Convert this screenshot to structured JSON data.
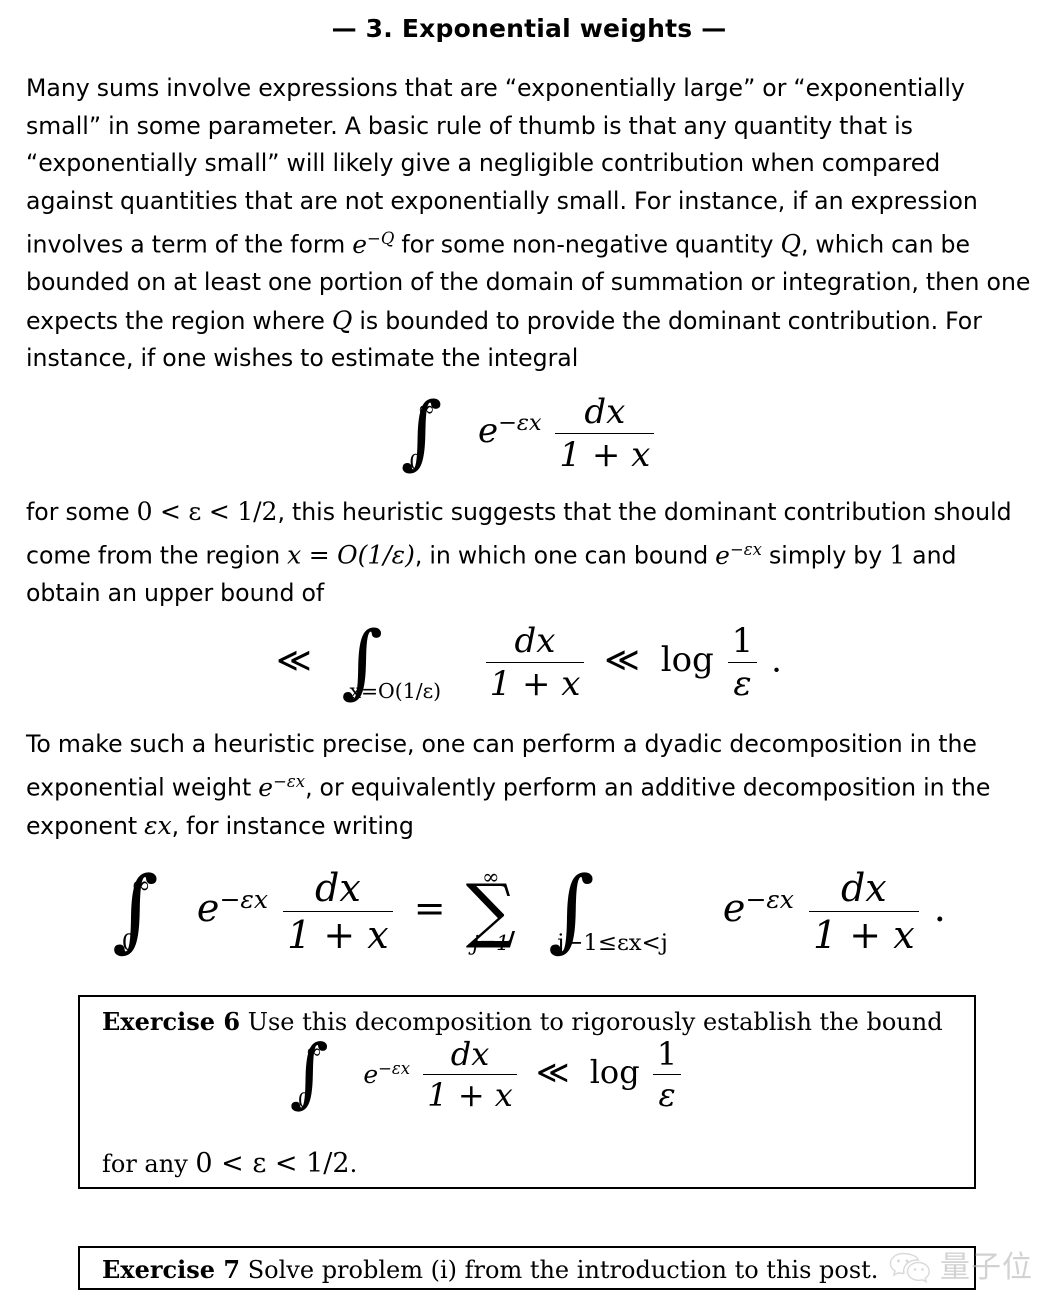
{
  "document": {
    "title": "— 3. Exponential weights —",
    "paragraphs": {
      "p1": {
        "seg1": "Many sums involve expressions that are “exponentially large” or “exponentially small” in some parameter. A basic rule of thumb is that any quantity that is “exponentially small” will likely give a negligible contribution when compared against quantities that are not exponentially small. For instance, if an expression involves a term of the form ",
        "math1_base": "e",
        "math1_exp": "−Q",
        "seg2": " for some non-negative quantity ",
        "math2": "Q",
        "seg3": ", which can be bounded on at least one portion of the domain of summation or integration, then one expects the region where ",
        "math3": "Q",
        "seg4": " is bounded to provide the dominant contribution. For instance, if one wishes to estimate the integral"
      },
      "p2": {
        "seg1": "for some ",
        "math1": "0 < ε < 1/2",
        "seg2": ", this heuristic suggests that the dominant contribution should come from the region ",
        "math2": "x = O(1/ε)",
        "seg3": ", in which one can bound ",
        "math3_base": "e",
        "math3_exp": "−εx",
        "seg4": " simply by ",
        "math4": "1",
        "seg5": " and obtain an upper bound of"
      },
      "p3": {
        "seg1": "To make such a heuristic precise, one can perform a dyadic decomposition in the exponential weight ",
        "math1_base": "e",
        "math1_exp": "−εx",
        "seg2": ", or equivalently perform an additive decomposition in the exponent ",
        "math2": "εx",
        "seg3": ", for instance writing"
      }
    },
    "equations": {
      "eq1": {
        "integral_lower": "0",
        "integral_upper": "∞",
        "exp_base": "e",
        "exp_sup": "−εx",
        "frac_num": "dx",
        "frac_den": "1 + x"
      },
      "eq2": {
        "lead_op": "≪",
        "integral_lower": "x=O(1/ε)",
        "frac_num": "dx",
        "frac_den": "1 + x",
        "mid_op": "≪",
        "log": "log",
        "log_num": "1",
        "log_den": "ε",
        "period": "."
      },
      "eq3": {
        "lhs_integral_lower": "0",
        "lhs_integral_upper": "∞",
        "lhs_exp_base": "e",
        "lhs_exp_sup": "−εx",
        "lhs_frac_num": "dx",
        "lhs_frac_den": "1 + x",
        "equals": "=",
        "sum_symbol": "∑",
        "sum_lower": "j=1",
        "sum_upper": "∞",
        "rhs_integral_lower": "j−1≤εx<j",
        "rhs_exp_base": "e",
        "rhs_exp_sup": "−εx",
        "rhs_frac_num": "dx",
        "rhs_frac_den": "1 + x",
        "period": "."
      }
    },
    "exercises": [
      {
        "label": "Exercise 6",
        "text": "Use this decomposition to rigorously establish the bound",
        "equation": {
          "integral_lower": "0",
          "integral_upper": "∞",
          "exp_base": "e",
          "exp_sup": "−εx",
          "frac_num": "dx",
          "frac_den": "1 + x",
          "op": "≪",
          "log": "log",
          "log_num": "1",
          "log_den": "ε"
        },
        "footer_text": "for any ",
        "footer_math": "0 < ε < 1/2",
        "footer_period": "."
      },
      {
        "label": "Exercise 7",
        "text": "Solve problem (i) from the introduction to this post."
      }
    ],
    "watermark": {
      "icon": "wechat-icon",
      "text": "量子位"
    },
    "colors": {
      "text": "#000000",
      "background": "#ffffff",
      "border": "#000000",
      "watermark": "#b8b8b8"
    }
  }
}
